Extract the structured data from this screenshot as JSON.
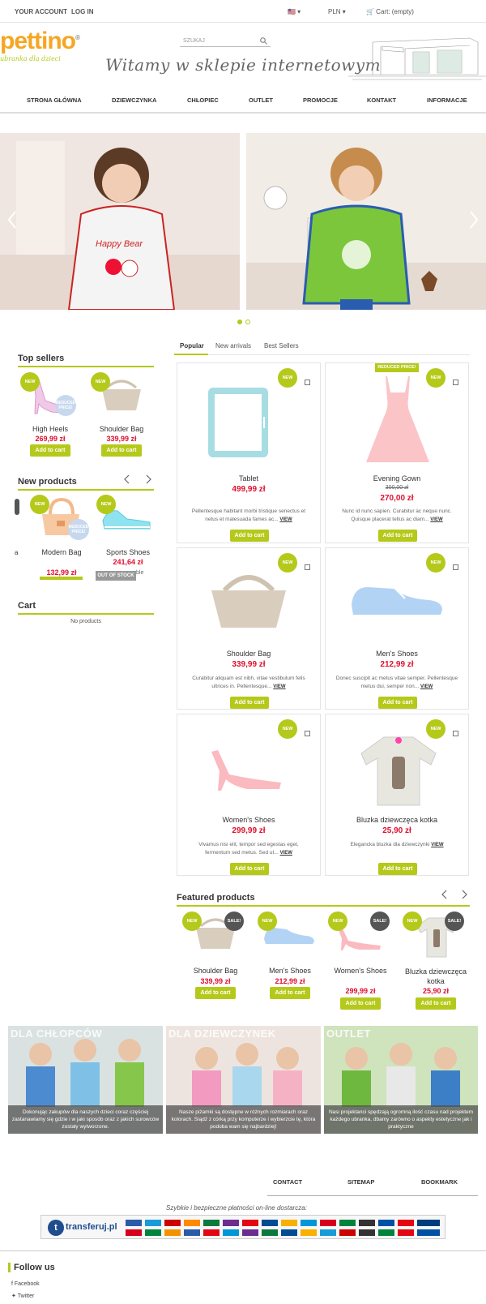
{
  "topbar": {
    "account": "YOUR ACCOUNT",
    "login": "LOG IN",
    "flag": "🇺🇸 ▾",
    "currency": "PLN ▾",
    "cart": "🛒 Cart: (empty)"
  },
  "logo": {
    "word": "pettino",
    "sub": "ubranka dla dzieci",
    "mark": "®"
  },
  "search": {
    "placeholder": "SZUKAJ"
  },
  "welcome": "Witamy w sklepie internetowym",
  "menu": [
    "STRONA GŁÓWNA",
    "DZIEWCZYNKA",
    "CHŁOPIEC",
    "OUTLET",
    "PROMOCJE",
    "KONTAKT",
    "INFORMACJE"
  ],
  "sidebar": {
    "top_sellers": {
      "title": "Top sellers",
      "items": [
        {
          "name": "High Heels",
          "price": "269,99 zł",
          "btn": "Add to cart",
          "badge": "NEW",
          "reduced": "REDUCED PRICE!"
        },
        {
          "name": "Shoulder Bag",
          "price": "339,99 zł",
          "btn": "Add to cart",
          "badge": "NEW"
        }
      ]
    },
    "new_products": {
      "title": "New products",
      "items": [
        {
          "name": "Modern Bag",
          "price": "132,99 zł",
          "badge": "NEW",
          "reduced": "REDUCED PRICE!"
        },
        {
          "name": "Sports Shoes",
          "price": "241,64 zł",
          "badge": "NEW",
          "stock": "OUT OF STOCK",
          "extra": "ble"
        }
      ],
      "left_fragment": "a"
    },
    "cart": {
      "title": "Cart",
      "empty": "No products"
    }
  },
  "tabs": [
    "Popular",
    "New arrivals",
    "Best Sellers"
  ],
  "products": [
    {
      "name": "Tablet",
      "price": "499,99 zł",
      "desc": "Pellentesque habitant morbi tristique senectus et netus et malesuada fames ac...",
      "view": "VIEW",
      "btn": "Add to cart",
      "badge": "NEW"
    },
    {
      "name": "Evening Gown",
      "old_price": "300,00 zł",
      "price": "270,00 zł",
      "desc": "Nunc id nunc sapien. Curabitur ac neque nunc. Quisque placerat tellus ac diam...",
      "view": "VIEW",
      "btn": "Add to cart",
      "badge": "NEW",
      "reduced": "REDUCED PRICE!"
    },
    {
      "name": "Shoulder Bag",
      "price": "339,99 zł",
      "desc": "Curabitur aliquam est nibh, vitae vestibulum felis ultrices in. Pellentesque...",
      "view": "VIEW",
      "btn": "Add to cart",
      "badge": "NEW"
    },
    {
      "name": "Men's Shoes",
      "price": "212,99 zł",
      "desc": "Donec suscipit ac metus vitae semper. Pellentesque metus dui, semper non...",
      "view": "VIEW",
      "btn": "Add to cart",
      "badge": "NEW"
    },
    {
      "name": "Women's Shoes",
      "price": "299,99 zł",
      "desc": "Vivamus nisi elit, tempor sed egestas eget, fermentum sed metus. Sed ut...",
      "view": "VIEW",
      "btn": "Add to cart",
      "badge": "NEW"
    },
    {
      "name": "Bluzka dziewczęca kotka",
      "price": "25,90 zł",
      "desc": "Elegancka bluzka dla dziewczynki",
      "view": "VIEW",
      "btn": "Add to cart",
      "badge": "NEW"
    }
  ],
  "featured": {
    "title": "Featured products",
    "items": [
      {
        "name": "Shoulder Bag",
        "price": "339,99 zł",
        "btn": "Add to cart",
        "badge": "NEW",
        "sale": "SALE!"
      },
      {
        "name": "Men's Shoes",
        "price": "212,99 zł",
        "btn": "Add to cart",
        "badge": "NEW"
      },
      {
        "name": "Women's Shoes",
        "price": "299,99 zł",
        "btn": "Add to cart",
        "badge": "NEW",
        "sale": "SALE!"
      },
      {
        "name": "Bluzka dziewczęca kotka",
        "price": "25,90 zł",
        "btn": "Add to cart",
        "badge": "NEW",
        "sale": "SALE!"
      }
    ]
  },
  "banners": [
    {
      "title": "DLA CHŁOPCÓW",
      "caption": "Dokonując zakupów dla naszych dzieci coraz częściej zastanawiamy się gdzie i w jaki sposób oraz z jakich surowców zostały wytworzone."
    },
    {
      "title": "DLA DZIEWCZYNEK",
      "caption": "Nasze piżamki są dostępne w różnych rozmiarach oraz kolorach. Siądź z córką przy komputerze i wybierzcie tę, która podoba wam się najbardziej!"
    },
    {
      "title": "OUTLET",
      "caption": "Nasi projektanci spędzają ogromną ilość czasu nad projektem każdego ubranka, dbamy zarówno o aspekty estetyczne jak i praktyczne"
    }
  ],
  "footer": {
    "links": [
      "CONTACT",
      "SITEMAP",
      "BOOKMARK"
    ],
    "payments": "Szybkie i bezpieczne płatności on-line dostarcza:",
    "transferuj": "transferuj.pl",
    "follow": "Follow us",
    "facebook": "Facebook",
    "twitter": "Twitter"
  },
  "colors": {
    "accent": "#b5c91b",
    "price": "#e00f2d",
    "orange": "#f5a623"
  }
}
